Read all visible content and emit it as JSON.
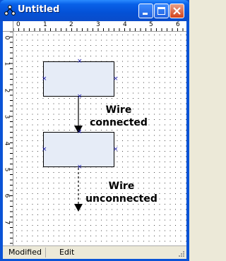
{
  "window": {
    "title": "Untitled"
  },
  "ruler": {
    "top_labels": [
      "0",
      "1",
      "2",
      "3",
      "4",
      "5",
      "6"
    ],
    "left_labels": [
      "0",
      "1",
      "2",
      "3",
      "4",
      "5",
      "6",
      "7"
    ]
  },
  "canvas": {
    "wire1_label_line1": "Wire",
    "wire1_label_line2": "connected",
    "wire2_label_line1": "Wire",
    "wire2_label_line2": "unconnected"
  },
  "statusbar": {
    "mode": "Modified",
    "state": "Edit"
  },
  "colors": {
    "titlebar": "#0451D6",
    "node_fill": "#E6ECF7",
    "port": "#1A1AAF"
  }
}
